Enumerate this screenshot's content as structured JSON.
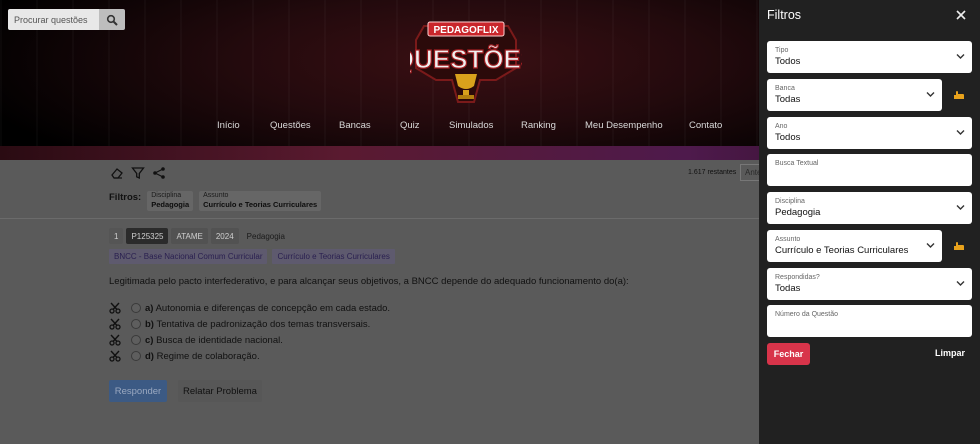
{
  "search": {
    "placeholder": "Procurar questões",
    "icon": "search-icon"
  },
  "logo": {
    "top_text": "PEDAGOFLIX",
    "main_text": "QUESTÕES"
  },
  "nav": [
    "Início",
    "Questões",
    "Bancas",
    "Quiz",
    "Simulados",
    "Ranking",
    "Meu Desempenho",
    "Contato"
  ],
  "toolbar": {
    "remaining": "1.617 restantes",
    "anterior": "Anterior"
  },
  "filters": {
    "label": "Filtros:",
    "chips": [
      {
        "key": "Disciplina",
        "value": "Pedagogia"
      },
      {
        "key": "Assunto",
        "value": "Currículo e Teorias Curriculares"
      }
    ]
  },
  "question": {
    "badges": [
      "1",
      "P125325",
      "ATAME",
      "2024",
      "Pedagogia"
    ],
    "tags": [
      "BNCC - Base Nacional Comum Curricular",
      "Currículo e Teorias Curriculares"
    ],
    "statement": "Legitimada pelo pacto interfederativo, e para alcançar seus objetivos, a BNCC depende do adequado funcionamento do(a):",
    "options": [
      {
        "letter": "a)",
        "text": "Autonomia e diferenças de concepção em cada estado."
      },
      {
        "letter": "b)",
        "text": "Tentativa de padronização dos temas transversais."
      },
      {
        "letter": "c)",
        "text": "Busca de identidade nacional."
      },
      {
        "letter": "d)",
        "text": "Regime de colaboração."
      }
    ],
    "responder": "Responder",
    "relatar": "Relatar Problema"
  },
  "panel": {
    "title": "Filtros",
    "fields": [
      {
        "label": "Tipo",
        "value": "Todos"
      },
      {
        "label": "Banca",
        "value": "Todas"
      },
      {
        "label": "Ano",
        "value": "Todos"
      },
      {
        "label": "Busca Textual",
        "value": ""
      },
      {
        "label": "Disciplina",
        "value": "Pedagogia"
      },
      {
        "label": "Assunto",
        "value": "Currículo e Teorias Curriculares"
      },
      {
        "label": "Respondidas?",
        "value": "Todas"
      },
      {
        "label": "Número da Questão",
        "value": ""
      }
    ],
    "fechar": "Fechar",
    "limpar": "Limpar"
  },
  "colors": {
    "accent_red": "#d8344a",
    "panel_bg": "#212121",
    "responder": "#3c5a84"
  }
}
